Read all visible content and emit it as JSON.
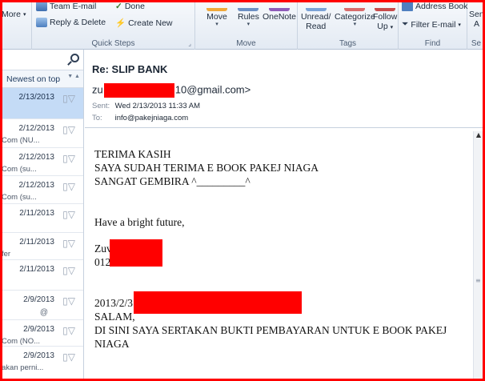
{
  "ribbon": {
    "left_item": "More",
    "quick_steps": {
      "items": [
        "Team E-mail",
        "Done",
        "Reply & Delete",
        "Create New"
      ],
      "label": "Quick Steps"
    },
    "move": {
      "move": "Move",
      "rules": "Rules",
      "onenote": "OneNote",
      "label": "Move"
    },
    "tags": {
      "unread_read": [
        "Unread/",
        "Read"
      ],
      "categorize": "Categorize",
      "follow_up": [
        "Follow",
        "Up"
      ],
      "label": "Tags"
    },
    "find": {
      "address_book": "Address Book",
      "filter_email": "Filter E-mail",
      "label": "Find"
    },
    "cut_right": {
      "top": "Sen",
      "mid": "A",
      "label": "Se"
    }
  },
  "list": {
    "sort_label": "Newest on top",
    "messages": [
      {
        "date": "2/13/2013",
        "sub": ""
      },
      {
        "date": "2/12/2013",
        "sub": "Com    (NU..."
      },
      {
        "date": "2/12/2013",
        "sub": "Com    (su..."
      },
      {
        "date": "2/12/2013",
        "sub": "Com    (su..."
      },
      {
        "date": "2/11/2013",
        "sub": ""
      },
      {
        "date": "2/11/2013",
        "sub": "fer"
      },
      {
        "date": "2/11/2013",
        "sub": ""
      },
      {
        "date": "2/9/2013",
        "sub": ""
      },
      {
        "date": "2/9/2013",
        "sub": "Com    (NO..."
      },
      {
        "date": "2/9/2013",
        "sub": "akan perni..."
      }
    ]
  },
  "message": {
    "subject": "Re: SLIP BANK",
    "from_prefix": "zu",
    "from_suffix": "10@gmail.com>",
    "sent_label": "Sent:",
    "sent_value": "Wed 2/13/2013 11:33 AM",
    "to_label": "To:",
    "to_value": "info@pakejniaga.com",
    "body": {
      "l1": "TERIMA KASIH",
      "l2": "SAYA SUDAH TERIMA E BOOK PAKEJ NIAGA",
      "l3": "SANGAT GEMBIRA ^_________^",
      "l4": "Have a bright future,",
      "sig1": "Zuv",
      "sig2": "012",
      "quote_date": "2013/2/3",
      "q1": "SALAM,",
      "q2": "DI SINI SAYA SERTAKAN BUKTI PEMBAYARAN UNTUK E BOOK PAKEJ",
      "q3": "NIAGA"
    }
  },
  "colors": {
    "redaction": "#ff0000",
    "selected_row": "#c4dbf6",
    "ribbon_accent": "#f0a93a"
  }
}
